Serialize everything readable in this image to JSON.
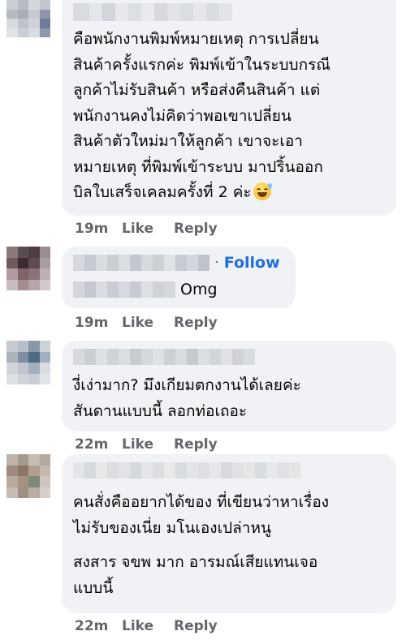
{
  "comments": [
    {
      "id": "c1",
      "lines": [
        "คือพนักงานพิมพ์หมายเหตุ การเปลี่ยน",
        "สินค้าครั้งแรกค่ะ พิมพ์เข้าในระบบกรณี",
        "ลูกค้าไม่รับสินค้า หรือส่งคืนสินค้า แต่",
        "พนักงานคงไม่คิดว่าพอเขาเปลี่ยน",
        "สินค้าตัวใหม่มาให้ลูกค้า เขาจะเอา",
        "หมายเหตุ ที่พิมพ์เข้าระบบ มาปริ้นออก",
        "บิลใบเสร็จเคลมครั้งที่ 2 ค่ะ"
      ],
      "emoji": "grinning-sweat-emoji",
      "time": "19m",
      "like": "Like",
      "reply": "Reply"
    },
    {
      "id": "c2",
      "follow": "Follow",
      "text": "Omg",
      "time": "19m",
      "like": "Like",
      "reply": "Reply"
    },
    {
      "id": "c3",
      "lines": [
        "งี่เง่ามาก? มึงเกียมตกงานได้เลยค่ะ",
        "สันดานแบบนี้ ลอกท่อเถอะ"
      ],
      "time": "22m",
      "like": "Like",
      "reply": "Reply"
    },
    {
      "id": "c4",
      "lines": [
        "คนสั่งคืออยากได้ของ ที่เขียนว่าหาเรื่อง",
        "ไม่รับของเนี่ย มโนเองเปล่าหนู",
        "สงสาร จขพ มาก อารมณ์เสียแทนเจอ",
        "แบบนี้"
      ],
      "time": "22m",
      "like": "Like",
      "reply": "Reply"
    }
  ],
  "colors": {
    "bubble": "#f0f2f5",
    "meta": "#65676b",
    "follow": "#216fdb",
    "text": "#050505"
  }
}
